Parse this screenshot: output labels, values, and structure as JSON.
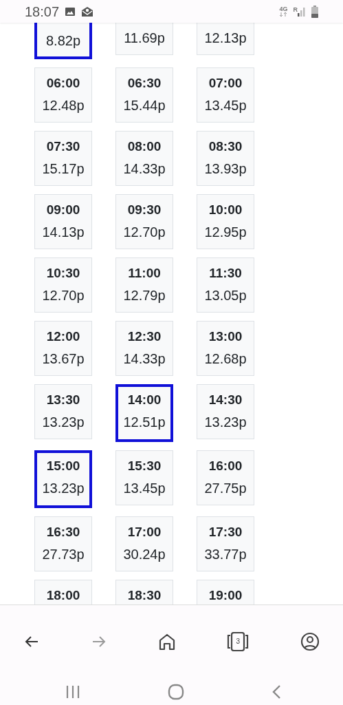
{
  "status_bar": {
    "time": "18:07",
    "network": "4G",
    "roaming": "R"
  },
  "slot_rows": [
    [
      {
        "price": "8.82p",
        "selected": true
      },
      {
        "price": "11.69p",
        "selected": false
      },
      {
        "price": "12.13p",
        "selected": false
      }
    ],
    [
      {
        "time": "06:00",
        "price": "12.48p",
        "selected": false
      },
      {
        "time": "06:30",
        "price": "15.44p",
        "selected": false
      },
      {
        "time": "07:00",
        "price": "13.45p",
        "selected": false
      }
    ],
    [
      {
        "time": "07:30",
        "price": "15.17p",
        "selected": false
      },
      {
        "time": "08:00",
        "price": "14.33p",
        "selected": false
      },
      {
        "time": "08:30",
        "price": "13.93p",
        "selected": false
      }
    ],
    [
      {
        "time": "09:00",
        "price": "14.13p",
        "selected": false
      },
      {
        "time": "09:30",
        "price": "12.70p",
        "selected": false
      },
      {
        "time": "10:00",
        "price": "12.95p",
        "selected": false
      }
    ],
    [
      {
        "time": "10:30",
        "price": "12.70p",
        "selected": false
      },
      {
        "time": "11:00",
        "price": "12.79p",
        "selected": false
      },
      {
        "time": "11:30",
        "price": "13.05p",
        "selected": false
      }
    ],
    [
      {
        "time": "12:00",
        "price": "13.67p",
        "selected": false
      },
      {
        "time": "12:30",
        "price": "14.33p",
        "selected": false
      },
      {
        "time": "13:00",
        "price": "12.68p",
        "selected": false
      }
    ],
    [
      {
        "time": "13:30",
        "price": "13.23p",
        "selected": false
      },
      {
        "time": "14:00",
        "price": "12.51p",
        "selected": true
      },
      {
        "time": "14:30",
        "price": "13.23p",
        "selected": false
      }
    ],
    [
      {
        "time": "15:00",
        "price": "13.23p",
        "selected": true
      },
      {
        "time": "15:30",
        "price": "13.45p",
        "selected": false
      },
      {
        "time": "16:00",
        "price": "27.75p",
        "selected": false
      }
    ],
    [
      {
        "time": "16:30",
        "price": "27.73p",
        "selected": false
      },
      {
        "time": "17:00",
        "price": "30.24p",
        "selected": false
      },
      {
        "time": "17:30",
        "price": "33.77p",
        "selected": false
      }
    ],
    [
      {
        "time": "18:00",
        "selected": false
      },
      {
        "time": "18:30",
        "selected": false
      },
      {
        "time": "19:00",
        "selected": false
      }
    ]
  ],
  "browser_toolbar": {
    "forward_enabled": false,
    "tab_count": "3"
  }
}
